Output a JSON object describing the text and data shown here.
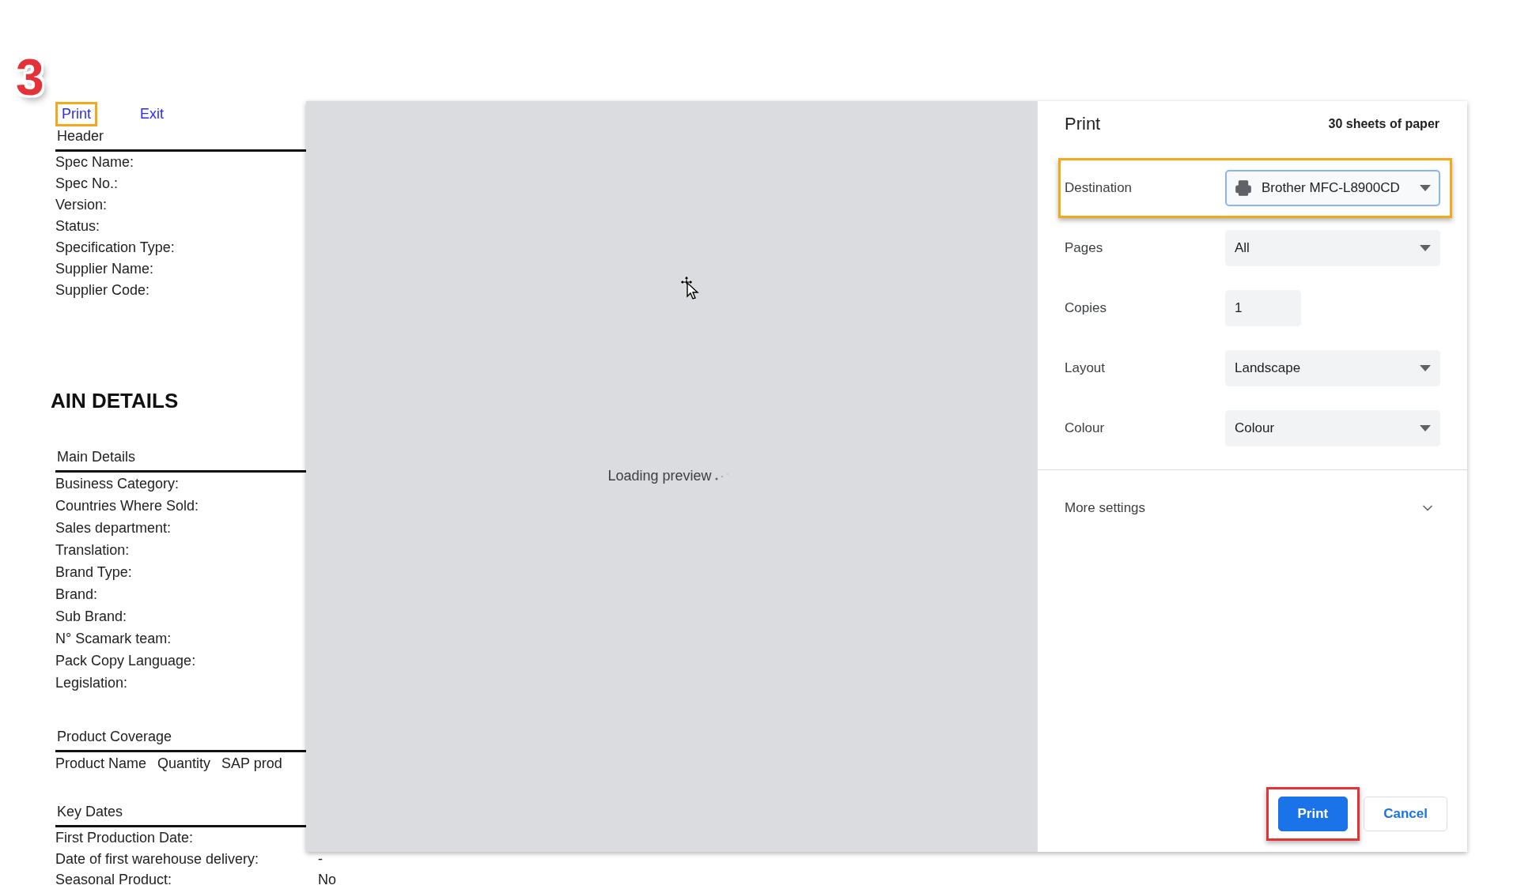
{
  "annotation": {
    "step": "3"
  },
  "document": {
    "links": [
      {
        "label": "Print",
        "highlighted": true
      },
      {
        "label": "Exit",
        "highlighted": false
      }
    ],
    "blocks": [
      {
        "kind": "section",
        "title": "Header",
        "fields": [
          {
            "label": "Spec Name:"
          },
          {
            "label": "Spec No.:"
          },
          {
            "label": "Version:"
          },
          {
            "label": "Status:"
          },
          {
            "label": "Specification Type:"
          },
          {
            "label": "Supplier Name:"
          },
          {
            "label": "Supplier Code:"
          }
        ]
      },
      {
        "kind": "heading",
        "title": "AIN DETAILS"
      },
      {
        "kind": "section",
        "title": "Main Details",
        "fields": [
          {
            "label": "Business Category:"
          },
          {
            "label": "Countries Where Sold:"
          },
          {
            "label": "Sales department:"
          },
          {
            "label": "Translation:"
          },
          {
            "label": "Brand Type:"
          },
          {
            "label": "Brand:"
          },
          {
            "label": "Sub Brand:"
          },
          {
            "label": "N° Scamark team:"
          },
          {
            "label": "Pack Copy Language:"
          },
          {
            "label": "Legislation:"
          }
        ]
      },
      {
        "kind": "table",
        "title": "Product Coverage",
        "columns": [
          "Product Name",
          "Quantity",
          "SAP prod"
        ]
      },
      {
        "kind": "section",
        "title": "Key Dates",
        "fields": [
          {
            "label": "First Production Date:"
          },
          {
            "label": "Date of first warehouse delivery:",
            "value": "-"
          },
          {
            "label": "Seasonal Product:",
            "value": "No"
          }
        ]
      }
    ]
  },
  "preview": {
    "message": "Loading preview"
  },
  "print_dialog": {
    "title": "Print",
    "summary": "30 sheets of paper",
    "settings": [
      {
        "kind": "select",
        "label": "Destination",
        "value": "Brother MFC-L8900CD",
        "highlighted": true,
        "focused": true
      },
      {
        "kind": "select",
        "label": "Pages",
        "value": "All",
        "highlighted": false,
        "focused": false
      },
      {
        "kind": "number",
        "label": "Copies",
        "value": "1",
        "highlighted": false,
        "focused": false
      },
      {
        "kind": "select",
        "label": "Layout",
        "value": "Landscape",
        "highlighted": false,
        "focused": false
      },
      {
        "kind": "select",
        "label": "Colour",
        "value": "Colour",
        "highlighted": false,
        "focused": false
      }
    ],
    "more_settings": {
      "label": "More settings",
      "expanded": false
    },
    "buttons": [
      {
        "kind": "primary",
        "label": "Print",
        "highlighted": true
      },
      {
        "kind": "secondary",
        "label": "Cancel",
        "highlighted": false
      }
    ]
  }
}
